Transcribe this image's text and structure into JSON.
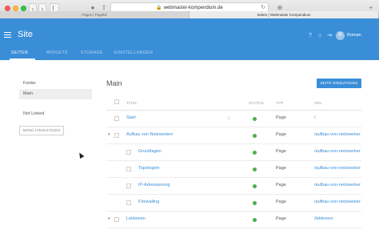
{
  "browser": {
    "url": "webmaster-kompendium.de",
    "tabs": [
      {
        "label": "Pages | Pagekit"
      },
      {
        "label": "Seiten | Webmaster Kompendium"
      }
    ]
  },
  "header": {
    "title": "Site",
    "user_initial": "R",
    "user_name": "Roman",
    "nav": [
      {
        "label": "SEITEN",
        "active": true
      },
      {
        "label": "WIDGETS",
        "active": false
      },
      {
        "label": "STORAGE",
        "active": false
      },
      {
        "label": "EINSTELLUNGEN",
        "active": false
      }
    ],
    "accent_color": "#3a8ed8"
  },
  "sidebar": {
    "menus": [
      {
        "label": "Footer",
        "active": false
      },
      {
        "label": "Main",
        "active": true
      }
    ],
    "not_linked": "Not Linked",
    "add_menu_label": "MENÜ HINZUFÜGEN"
  },
  "main": {
    "title": "Main",
    "add_page_label": "SEITE HINZUFÜGEN",
    "columns": {
      "title": "TITEL",
      "status": "STATUS",
      "type": "TYP",
      "url": "URL"
    },
    "rows": [
      {
        "title": "Start",
        "status": "enabled",
        "type": "Page",
        "url": "/",
        "home": true,
        "level": 0,
        "toggle": ""
      },
      {
        "title": "Aufbau von Netzwerken",
        "status": "enabled",
        "type": "Page",
        "url": "/aufbau-von-netzwerken",
        "level": 0,
        "toggle": "▾"
      },
      {
        "title": "Grundlagen",
        "status": "enabled",
        "type": "Page",
        "url": "/aufbau-von-netzwerken/grundlagen",
        "level": 1,
        "toggle": ""
      },
      {
        "title": "Topologien",
        "status": "enabled",
        "type": "Page",
        "url": "/aufbau-von-netzwerken/topologien",
        "level": 1,
        "toggle": ""
      },
      {
        "title": "IP-Adressierung",
        "status": "enabled",
        "type": "Page",
        "url": "/aufbau-von-netzwerken/ip-adressierung",
        "level": 1,
        "toggle": ""
      },
      {
        "title": "Firewalling",
        "status": "enabled",
        "type": "Page",
        "url": "/aufbau-von-netzwerken/firewalling",
        "level": 1,
        "toggle": ""
      },
      {
        "title": "Lektionen",
        "status": "enabled",
        "type": "Page",
        "url": "/lektionen",
        "level": 0,
        "toggle": "▾"
      }
    ],
    "status_color": "#4cae4c"
  }
}
